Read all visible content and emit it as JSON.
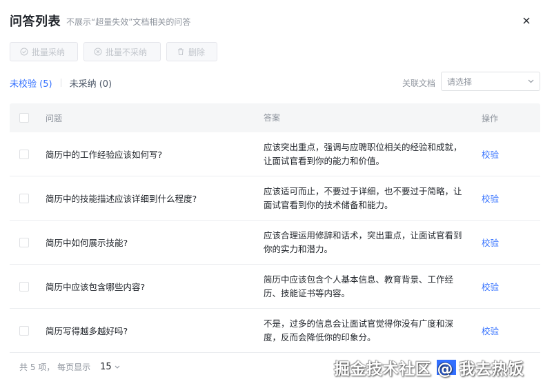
{
  "dialog": {
    "title": "问答列表",
    "subtitle": "不展示“超量失效”文档相关的问答"
  },
  "toolbar": {
    "batch_accept": "批量采纳",
    "batch_reject": "批量不采纳",
    "delete": "删除"
  },
  "filters": {
    "tab_unverified": "未校验 (5)",
    "tab_unaccepted": "未采纳 (0)",
    "related_doc_label": "关联文档",
    "related_doc_placeholder": "请选择"
  },
  "table": {
    "headers": {
      "question": "问题",
      "answer": "答案",
      "action": "操作"
    },
    "rows": [
      {
        "question": "简历中的工作经验应该如何写?",
        "answer": "应该突出重点，强调与应聘职位相关的经验和成就，让面试官看到你的能力和价值。",
        "action": "校验"
      },
      {
        "question": "简历中的技能描述应该详细到什么程度?",
        "answer": "应该适可而止，不要过于详细，也不要过于简略，让面试官看到你的技术储备和能力。",
        "action": "校验"
      },
      {
        "question": "简历中如何展示技能?",
        "answer": "应该合理运用修辞和话术，突出重点，让面试官看到你的实力和潜力。",
        "action": "校验"
      },
      {
        "question": "简历中应该包含哪些内容?",
        "answer": "简历中应该包含个人基本信息、教育背景、工作经历、技能证书等内容。",
        "action": "校验"
      },
      {
        "question": "简历写得越多越好吗?",
        "answer": "不是，过多的信息会让面试官觉得你没有广度和深度，反而会降低你的印象分。",
        "action": "校验"
      }
    ]
  },
  "pagination": {
    "summary": "共 5 项， 每页显示",
    "page_size": "15"
  },
  "watermark": "掘金技术社区 @ 我去热饭",
  "colors": {
    "accent": "#3370ff",
    "muted": "#8f959e",
    "disabled": "#c2c6cc"
  }
}
